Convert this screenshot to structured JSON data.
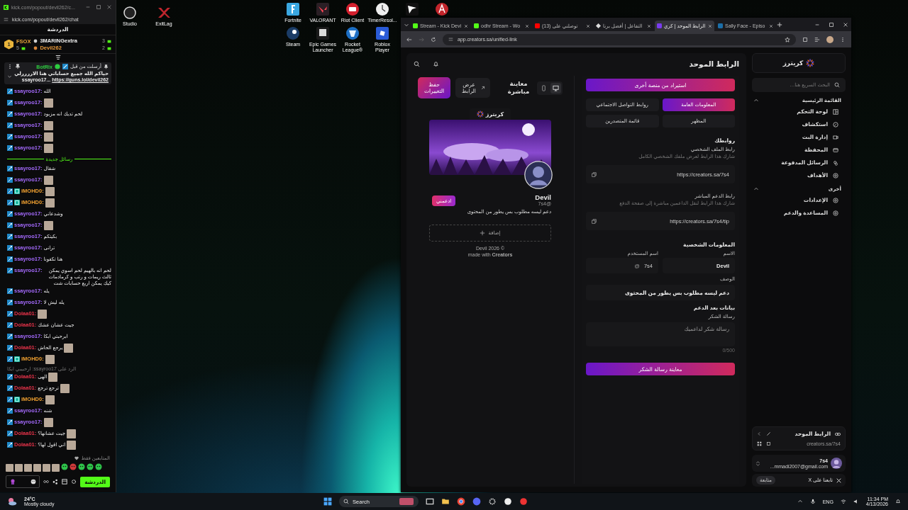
{
  "desktop": {
    "left_icons": [
      {
        "label": "ExitLag",
        "kind": "exitlag"
      },
      {
        "label": "Studio",
        "kind": "obs"
      }
    ],
    "icons": [
      {
        "kind": "red"
      },
      {
        "kind": "flag"
      },
      {
        "label": "TimerResol...",
        "kind": "timer"
      },
      {
        "label": "Riot Client",
        "kind": "riot"
      },
      {
        "label": "VALORANT",
        "kind": "valorant"
      },
      {
        "label": "Fortnite",
        "kind": "fortnite"
      },
      {
        "label": "Roblox Player",
        "kind": "roblox"
      },
      {
        "label": "Rocket League®",
        "kind": "rocket"
      },
      {
        "label": "Epic Games Launcher",
        "kind": "epic"
      },
      {
        "label": "Steam",
        "kind": "steam"
      }
    ]
  },
  "chat_window": {
    "title": "kick.com/popout/devil262/c...",
    "address": "kick.com/popout/devil262/chat",
    "heading": "الدردشة",
    "leaderboard": [
      {
        "name": "3MARINGextra",
        "count": "3",
        "color": "#f2f2f2"
      },
      {
        "name": "Devil262",
        "count": "2",
        "color": "#e89a3c"
      },
      {
        "rank": "1",
        "name": "FSOX",
        "count": "5",
        "color": "#e9a53c"
      }
    ],
    "pinned": {
      "sent_by": "أرسلت من قبل",
      "author": "BotRix",
      "text": "حياكم الله جميع حساباتي هنا الاررررلي",
      "link": "https://guns.lol/devil262",
      "suffix": "ssayroo17..."
    },
    "messages": [
      {
        "kind": "message",
        "user": "ssayroo17:",
        "color": "#a66bff",
        "text": "الله",
        "emote": false,
        "subscriber": false
      },
      {
        "kind": "message",
        "user": "ssayroo17:",
        "color": "#a66bff",
        "emote": true,
        "subscriber": false
      },
      {
        "kind": "message",
        "user": "ssayroo17:",
        "color": "#a66bff",
        "text": "لحم تديك انه مزبود",
        "emote": false,
        "subscriber": false
      },
      {
        "kind": "message",
        "user": "ssayroo17:",
        "color": "#a66bff",
        "emote": true,
        "subscriber": false
      },
      {
        "kind": "message",
        "user": "ssayroo17:",
        "color": "#a66bff",
        "emote": true,
        "subscriber": false
      },
      {
        "kind": "message",
        "user": "ssayroo17:",
        "color": "#a66bff",
        "emote": true,
        "subscriber": false
      },
      {
        "kind": "divider",
        "text": "رسائل جديدة"
      },
      {
        "kind": "message",
        "user": "ssayroo17:",
        "color": "#a66bff",
        "text": "شقال",
        "emote": false,
        "subscriber": false
      },
      {
        "kind": "message",
        "user": "ssayroo17:",
        "color": "#a66bff",
        "emote": true,
        "subscriber": false
      },
      {
        "kind": "message",
        "user": "iMOHD0:",
        "color": "#f0a030",
        "emote": true,
        "subscriber": true
      },
      {
        "kind": "message",
        "user": "iMOHD0:",
        "color": "#f0a030",
        "emote": true,
        "subscriber": true
      },
      {
        "kind": "message",
        "user": "ssayroo17:",
        "color": "#a66bff",
        "text": "وشدعاني",
        "emote": false,
        "subscriber": false
      },
      {
        "kind": "message",
        "user": "ssayroo17:",
        "color": "#a66bff",
        "emote": true,
        "subscriber": false
      },
      {
        "kind": "message",
        "user": "ssayroo17:",
        "color": "#a66bff",
        "text": "بكيتكم",
        "emote": false,
        "subscriber": false
      },
      {
        "kind": "message",
        "user": "ssayroo17:",
        "color": "#a66bff",
        "text": "ترانى",
        "emote": false,
        "subscriber": false
      },
      {
        "kind": "message",
        "user": "ssayroo17:",
        "color": "#a66bff",
        "text": "هنا تكفونا",
        "emote": false,
        "subscriber": false
      },
      {
        "kind": "message",
        "user": "ssayroo17:",
        "color": "#a66bff",
        "text": "لحم انه بالهيم لحم اسوي يمكن ثالث ريمات و رتب و كرمادمات كيك يمكن اربع حسابات شت",
        "emote": false,
        "subscriber": false
      },
      {
        "kind": "message",
        "user": "ssayroo17:",
        "color": "#a66bff",
        "text": "يله",
        "emote": false,
        "subscriber": false
      },
      {
        "kind": "message",
        "user": "ssayroo17:",
        "color": "#a66bff",
        "text": "يله ليش لا",
        "emote": false,
        "subscriber": false
      },
      {
        "kind": "message",
        "user": "Dolaa01:",
        "color": "#e8334a",
        "emote": true,
        "subscriber": false
      },
      {
        "kind": "message",
        "user": "Dolaa01:",
        "color": "#e8334a",
        "text": "جيت عشان عشك",
        "emote": false,
        "subscriber": false
      },
      {
        "kind": "message",
        "user": "ssayroo17:",
        "color": "#a66bff",
        "text": "ابرحبتي ابكا",
        "emote": false,
        "subscriber": false
      },
      {
        "kind": "message",
        "user": "Dolaa01:",
        "color": "#e8334a",
        "text": "يرجع الحاش",
        "emote": true,
        "subscriber": false
      },
      {
        "kind": "message",
        "user": "iMOHD0:",
        "color": "#f0a030",
        "emote": true,
        "subscriber": true
      },
      {
        "kind": "reply",
        "text": "الرد على ssayroo17: ارحبيبي ابكا"
      },
      {
        "kind": "message",
        "user": "Dolaa01:",
        "color": "#e8334a",
        "text": "الهى",
        "emote": true,
        "subscriber": false
      },
      {
        "kind": "message",
        "user": "Dolaa01:",
        "color": "#e8334a",
        "text": "ترجع ترجع",
        "emote": true,
        "subscriber": false
      },
      {
        "kind": "message",
        "user": "iMOHD0:",
        "color": "#f0a030",
        "emote": true,
        "subscriber": true
      },
      {
        "kind": "message",
        "user": "ssayroo17:",
        "color": "#a66bff",
        "text": "شنه",
        "emote": false,
        "subscriber": false
      },
      {
        "kind": "message",
        "user": "ssayroo17:",
        "color": "#a66bff",
        "emote": true,
        "subscriber": false
      },
      {
        "kind": "message",
        "user": "Dolaa01:",
        "color": "#e8334a",
        "text": "جيت عشانها؟",
        "emote": true,
        "subscriber": false
      },
      {
        "kind": "message",
        "user": "Dolaa01:",
        "color": "#e8334a",
        "text": "اني اقول لها؟",
        "emote": true,
        "subscriber": false
      }
    ],
    "mode_label": "المتابعين فقط",
    "send_button": "الدردشة"
  },
  "browser": {
    "tabs": [
      {
        "title": "Sally Face - Episo",
        "kind": "steam",
        "selected": false
      },
      {
        "title": "الرابط الموحد | كري",
        "kind": "creators",
        "selected": true
      },
      {
        "title": "التفاعل | أفضل برنا",
        "kind": "diamond",
        "selected": false
      },
      {
        "title": "(13) توصلني على",
        "kind": "youtube",
        "selected": false
      },
      {
        "title": "odhr Stream - Wo",
        "kind": "kick",
        "selected": false
      },
      {
        "title": "Stream - Kick Devi",
        "kind": "kick",
        "selected": false
      }
    ],
    "address": "app.creators.sa/unified-link"
  },
  "sidebar": {
    "logo": "كريترز",
    "search_placeholder": "البحث السريع هنا...",
    "sections": [
      {
        "title": "القائمة الرئيسية",
        "expanded": true,
        "items": [
          {
            "label": "لوحة التحكم",
            "kind": "dashboard"
          },
          {
            "label": "استكشاف",
            "kind": "explore"
          },
          {
            "label": "إدارة البث",
            "kind": "stream"
          },
          {
            "label": "المحفظة",
            "kind": "wallet"
          },
          {
            "label": "الرسائل المدفوعة",
            "kind": "messages"
          },
          {
            "label": "الأهداف",
            "kind": "goals"
          }
        ]
      },
      {
        "title": "أخرى",
        "expanded": true,
        "items": [
          {
            "label": "الإعدادات",
            "kind": "settings"
          },
          {
            "label": "المساعدة والدعم",
            "kind": "help"
          }
        ]
      }
    ],
    "link_card": {
      "title": "الرابط الموحد",
      "url": "creators.sa/7s4"
    },
    "user": {
      "name": "7s4",
      "email": "...mmadi2007@gmail.com"
    },
    "follow": {
      "label": "تابعنا على X",
      "button": "متابعة"
    }
  },
  "page": {
    "title": "الرابط الموحد",
    "preview": {
      "title": "معاينة مباشرة",
      "devices": [
        {
          "kind": "desktop",
          "selected": true
        },
        {
          "kind": "mobile",
          "selected": false
        }
      ],
      "view_button": "عرض الرابط",
      "save_button": "حفظ التغييرات",
      "logo": "كريترز",
      "name": "Devil",
      "handle": "7s4@",
      "support_button": "ادعمني",
      "bio": "دعم ليسه مطلوب بس يطور من المحتوى",
      "add_button": "إضافة",
      "footer": "Devil 2026 ©",
      "made_with": "made with **Creators**"
    },
    "editor": {
      "import_button": "استيراد من منصة أخرى",
      "tabs": [
        {
          "label": "المعلومات العامة",
          "selected": true
        },
        {
          "label": "روابط التواصل الاجتماعي",
          "selected": false
        },
        {
          "label": "المظهر",
          "selected": false
        },
        {
          "label": "قائمة المتصدرين",
          "selected": false
        }
      ],
      "links_title": "روابطك",
      "links": [
        {
          "label": "رابط الملف الشخصي",
          "hint": "شارك هذا الرابط لعرض ملفك الشخصي الكامل",
          "value": "https://creators.sa/7s4"
        },
        {
          "label": "رابط الدعم المباشر",
          "hint": "شارك هذا الرابط لنقل الداعمين مباشرة إلى صفحة الدفع",
          "value": "https://creators.sa/7s4/tip"
        }
      ],
      "personal_title": "المعلومات الشخصية",
      "name_label": "الاسم",
      "name_value": "Devil",
      "username_label": "اسم المستخدم",
      "username_value": "7s4",
      "at": "@",
      "description_label": "الوصف",
      "description_value": "دعم ليسه مطلوب بس يطور من المحتوى",
      "after_title": "بيانات بعد الدعم",
      "thanks_label": "رسالة الشكر",
      "thanks_placeholder": "رسالة شكر لداعميك",
      "counter": "0/500",
      "preview_button": "معاينة رسالة الشكر"
    }
  },
  "taskbar": {
    "temperature": "24°C",
    "weather": "Mostly cloudy",
    "search": "Search",
    "language": "ENG",
    "time": "11:34 PM",
    "date": "4/13/2026"
  }
}
